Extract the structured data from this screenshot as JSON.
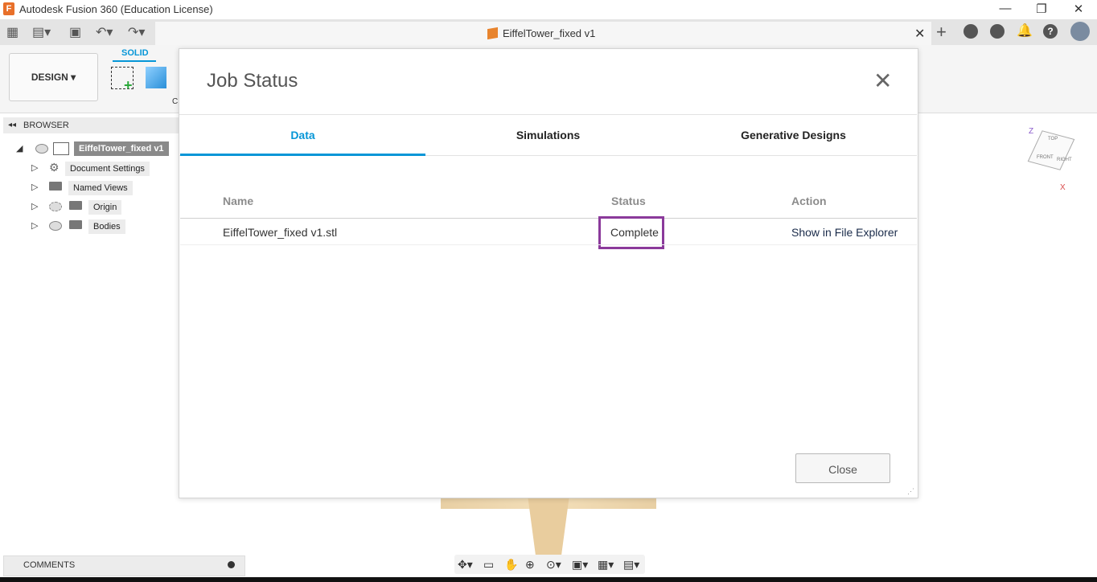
{
  "window": {
    "title": "Autodesk Fusion 360 (Education License)",
    "logo": "F",
    "minimize": "—",
    "restore": "❐",
    "close": "✕"
  },
  "toolbar": {
    "grid": "▦",
    "file": "▤▾",
    "save": "▣",
    "undo": "↶▾",
    "redo": "↷▾"
  },
  "document_tab": {
    "title": "EiffelTower_fixed v1",
    "close": "✕",
    "new_tab": "+"
  },
  "ribbon": {
    "workspace": "DESIGN ▾",
    "active_tab": "SOLID",
    "create_label_fragment": "C"
  },
  "browser": {
    "title": "BROWSER",
    "collapse": "◂◂",
    "root": "EiffelTower_fixed v1",
    "items": [
      {
        "label": "Document Settings"
      },
      {
        "label": "Named Views"
      },
      {
        "label": "Origin"
      },
      {
        "label": "Bodies"
      }
    ]
  },
  "viewcube": {
    "z": "Z",
    "x": "X",
    "top": "TOP",
    "front": "FRONT",
    "right": "RIGHT"
  },
  "comments": {
    "label": "COMMENTS"
  },
  "dialog": {
    "title": "Job Status",
    "close_icon": "✕",
    "tabs": [
      {
        "label": "Data",
        "active": true
      },
      {
        "label": "Simulations",
        "active": false
      },
      {
        "label": "Generative Designs",
        "active": false
      }
    ],
    "columns": {
      "name": "Name",
      "status": "Status",
      "action": "Action"
    },
    "rows": [
      {
        "name": "EiffelTower_fixed v1.stl",
        "status": "Complete",
        "action": "Show in File Explorer"
      }
    ],
    "close_button": "Close"
  },
  "colors": {
    "accent": "#0696d7",
    "highlight": "#8b3a9b"
  }
}
